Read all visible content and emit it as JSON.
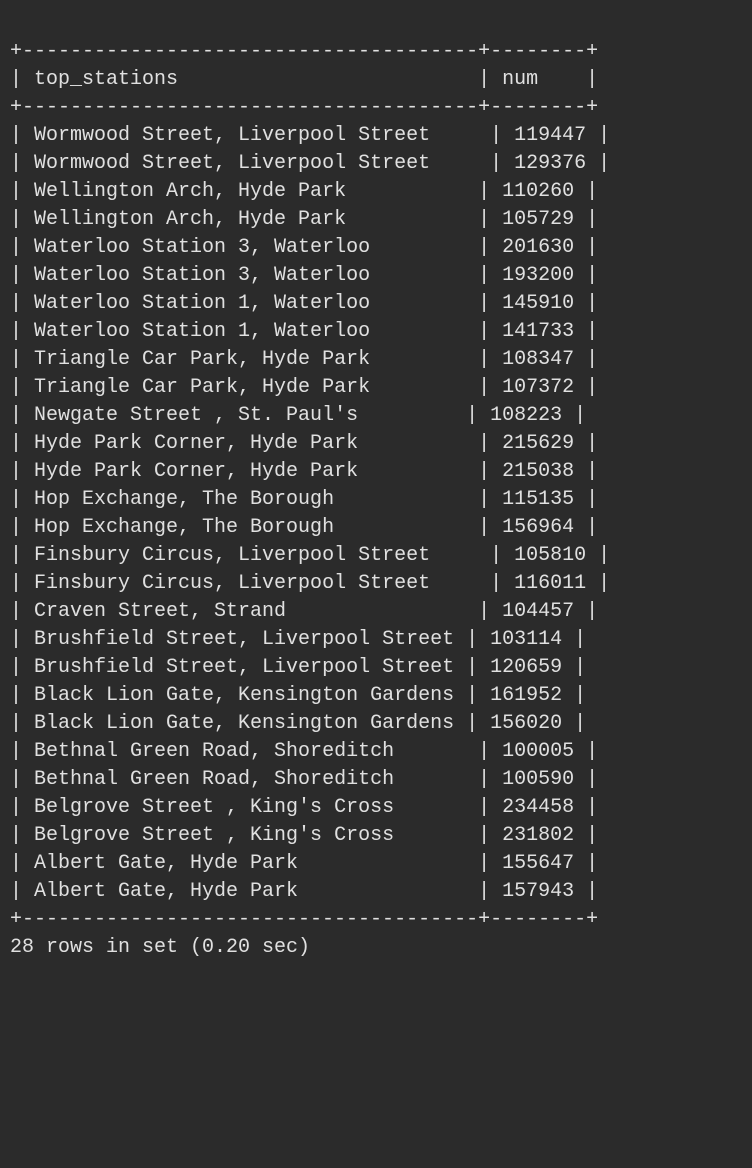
{
  "borders": {
    "top": "+--------------------------------------+--------+",
    "mid": "+--------------------------------------+--------+",
    "bottom": "+--------------------------------------+--------+"
  },
  "headers": {
    "col1": "top_stations",
    "col2": "num"
  },
  "rows": [
    {
      "station": "Wormwood Street, Liverpool Street",
      "num": "119447"
    },
    {
      "station": "Wormwood Street, Liverpool Street",
      "num": "129376"
    },
    {
      "station": "Wellington Arch, Hyde Park",
      "num": "110260"
    },
    {
      "station": "Wellington Arch, Hyde Park",
      "num": "105729"
    },
    {
      "station": "Waterloo Station 3, Waterloo",
      "num": "201630"
    },
    {
      "station": "Waterloo Station 3, Waterloo",
      "num": "193200"
    },
    {
      "station": "Waterloo Station 1, Waterloo",
      "num": "145910"
    },
    {
      "station": "Waterloo Station 1, Waterloo",
      "num": "141733"
    },
    {
      "station": "Triangle Car Park, Hyde Park",
      "num": "108347"
    },
    {
      "station": "Triangle Car Park, Hyde Park",
      "num": "107372"
    },
    {
      "station": "Newgate Street , St. Paul's",
      "num": "108223"
    },
    {
      "station": "Hyde Park Corner, Hyde Park",
      "num": "215629"
    },
    {
      "station": "Hyde Park Corner, Hyde Park",
      "num": "215038"
    },
    {
      "station": "Hop Exchange, The Borough",
      "num": "115135"
    },
    {
      "station": "Hop Exchange, The Borough",
      "num": "156964"
    },
    {
      "station": "Finsbury Circus, Liverpool Street",
      "num": "105810"
    },
    {
      "station": "Finsbury Circus, Liverpool Street",
      "num": "116011"
    },
    {
      "station": "Craven Street, Strand",
      "num": "104457"
    },
    {
      "station": "Brushfield Street, Liverpool Street",
      "num": "103114"
    },
    {
      "station": "Brushfield Street, Liverpool Street",
      "num": "120659"
    },
    {
      "station": "Black Lion Gate, Kensington Gardens",
      "num": "161952"
    },
    {
      "station": "Black Lion Gate, Kensington Gardens",
      "num": "156020"
    },
    {
      "station": "Bethnal Green Road, Shoreditch",
      "num": "100005"
    },
    {
      "station": "Bethnal Green Road, Shoreditch",
      "num": "100590"
    },
    {
      "station": "Belgrove Street , King's Cross",
      "num": "234458"
    },
    {
      "station": "Belgrove Street , King's Cross",
      "num": "231802"
    },
    {
      "station": "Albert Gate, Hyde Park",
      "num": "155647"
    },
    {
      "station": "Albert Gate, Hyde Park",
      "num": "157943"
    }
  ],
  "summary": "28 rows in set (0.20 sec)"
}
